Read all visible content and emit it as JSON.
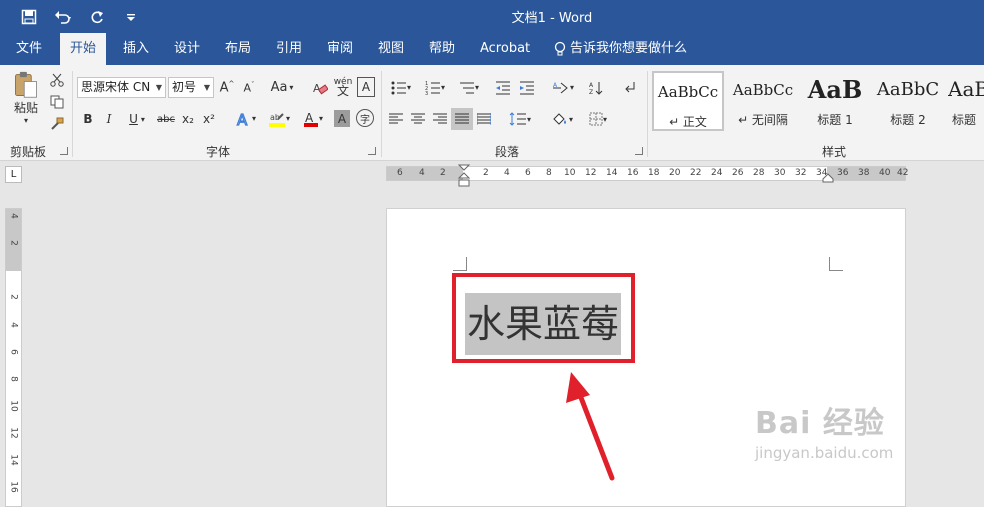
{
  "window": {
    "title": "文档1  -  Word"
  },
  "tabs": [
    {
      "label": "文件"
    },
    {
      "label": "开始"
    },
    {
      "label": "插入"
    },
    {
      "label": "设计"
    },
    {
      "label": "布局"
    },
    {
      "label": "引用"
    },
    {
      "label": "审阅"
    },
    {
      "label": "视图"
    },
    {
      "label": "帮助"
    },
    {
      "label": "Acrobat"
    }
  ],
  "tell_me": "告诉我你想要做什么",
  "clipboard": {
    "paste_label": "粘贴",
    "group_label": "剪贴板"
  },
  "font": {
    "name": "思源宋体 CN",
    "size": "初号",
    "group_label": "字体",
    "change_case": "Aa",
    "bold": "B",
    "italic": "I",
    "underline": "U",
    "strike": "abc",
    "sub": "x₂",
    "sup": "x²",
    "wen": "wén",
    "border_char": "A"
  },
  "paragraph": {
    "group_label": "段落"
  },
  "styles": {
    "group_label": "样式",
    "items": [
      {
        "sample": "AaBbCc",
        "name": "↵ 正文"
      },
      {
        "sample": "AaBbCc",
        "name": "↵ 无间隔"
      },
      {
        "sample": "AaB",
        "name": "标题 1"
      },
      {
        "sample": "AaBbC",
        "name": "标题 2"
      },
      {
        "sample": "AaB",
        "name": "标题"
      }
    ]
  },
  "ruler": {
    "h_ticks": [
      "6",
      "4",
      "2",
      "2",
      "4",
      "6",
      "8",
      "10",
      "12",
      "14",
      "16",
      "18",
      "20",
      "22",
      "24",
      "26",
      "28",
      "30",
      "32",
      "34",
      "36",
      "38",
      "40",
      "42"
    ],
    "v_ticks": [
      "4",
      "2",
      "2",
      "4",
      "6",
      "8",
      "10",
      "12",
      "14",
      "16"
    ],
    "toggle": "L"
  },
  "document": {
    "text": "水果蓝莓"
  },
  "watermark": {
    "main": "Bai 经验",
    "sub": "jingyan.baidu.com"
  },
  "colors": {
    "accent": "#2b579a",
    "highlight_box": "#e0202a",
    "selection": "#c4c4c4"
  }
}
